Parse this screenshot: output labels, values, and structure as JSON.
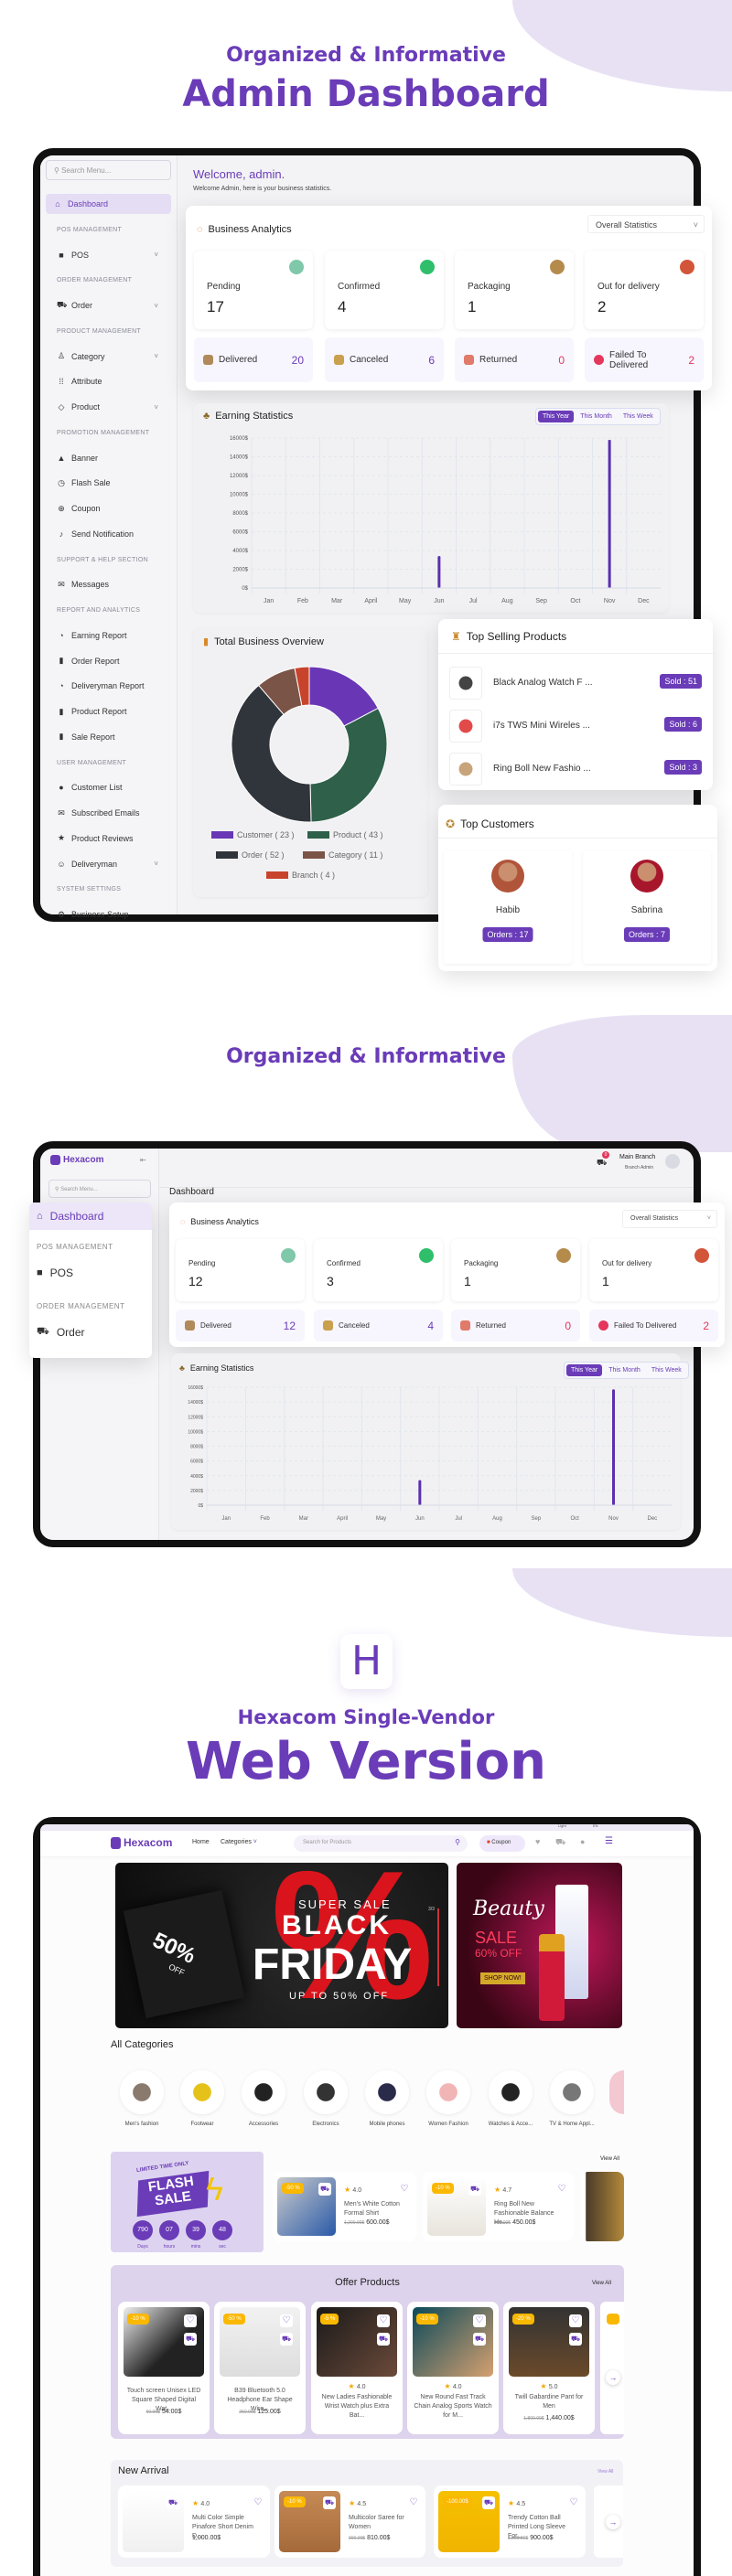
{
  "colors": {
    "accent": "#6a3cb8",
    "danger": "#e5365b",
    "lavender": "#e8e1f4",
    "bar": "#5b2fb0"
  },
  "section1": {
    "kicker": "Organized & Informative",
    "title": "Admin Dashboard"
  },
  "admin": {
    "search_placeholder": "Search Menu...",
    "sidebar": [
      {
        "type": "item",
        "label": "Dashboard",
        "icon": "home-icon",
        "active": true
      },
      {
        "type": "header",
        "label": "POS MANAGEMENT"
      },
      {
        "type": "item",
        "label": "POS",
        "icon": "bag-icon",
        "chevron": true
      },
      {
        "type": "header",
        "label": "ORDER MANAGEMENT"
      },
      {
        "type": "item",
        "label": "Order",
        "icon": "cart-icon",
        "chevron": true
      },
      {
        "type": "header",
        "label": "PRODUCT MANAGEMENT"
      },
      {
        "type": "item",
        "label": "Category",
        "icon": "category-icon",
        "chevron": true
      },
      {
        "type": "item",
        "label": "Attribute",
        "icon": "grid-icon"
      },
      {
        "type": "item",
        "label": "Product",
        "icon": "product-icon",
        "chevron": true
      },
      {
        "type": "header",
        "label": "PROMOTION MANAGEMENT"
      },
      {
        "type": "item",
        "label": "Banner",
        "icon": "image-icon"
      },
      {
        "type": "item",
        "label": "Flash Sale",
        "icon": "alarm-icon"
      },
      {
        "type": "item",
        "label": "Coupon",
        "icon": "coupon-icon"
      },
      {
        "type": "item",
        "label": "Send Notification",
        "icon": "bell-icon"
      },
      {
        "type": "header",
        "label": "SUPPORT & HELP SECTION"
      },
      {
        "type": "item",
        "label": "Messages",
        "icon": "message-icon"
      },
      {
        "type": "header",
        "label": "REPORT AND ANALYTICS"
      },
      {
        "type": "item",
        "label": "Earning Report",
        "icon": "pie-icon"
      },
      {
        "type": "item",
        "label": "Order Report",
        "icon": "bar-chart-icon"
      },
      {
        "type": "item",
        "label": "Deliveryman Report",
        "icon": "pie-icon"
      },
      {
        "type": "item",
        "label": "Product Report",
        "icon": "bar-chart-icon"
      },
      {
        "type": "item",
        "label": "Sale Report",
        "icon": "bar-chart-icon"
      },
      {
        "type": "header",
        "label": "USER MANAGEMENT"
      },
      {
        "type": "item",
        "label": "Customer List",
        "icon": "user-icon"
      },
      {
        "type": "item",
        "label": "Subscribed Emails",
        "icon": "mail-icon"
      },
      {
        "type": "item",
        "label": "Product Reviews",
        "icon": "star-icon"
      },
      {
        "type": "item",
        "label": "Deliveryman",
        "icon": "person-icon",
        "chevron": true
      },
      {
        "type": "header",
        "label": "SYSTEM SETTINGS"
      },
      {
        "type": "item",
        "label": "Business Setup",
        "icon": "gear-icon"
      }
    ],
    "welcome": "Welcome, admin.",
    "welcome_sub": "Welcome Admin, here is your business statistics.",
    "analytics": {
      "title": "Business Analytics",
      "filter": "Overall Statistics",
      "stats": [
        {
          "label": "Pending",
          "value": "17",
          "color": "#7fc8a9"
        },
        {
          "label": "Confirmed",
          "value": "4",
          "color": "#2fbf6b"
        },
        {
          "label": "Packaging",
          "value": "1",
          "color": "#b58b4c"
        },
        {
          "label": "Out for delivery",
          "value": "2",
          "color": "#d2553a"
        }
      ],
      "statuses": [
        {
          "label": "Delivered",
          "value": "20",
          "color": "#6a3cb8",
          "icon": "#b08a5a"
        },
        {
          "label": "Canceled",
          "value": "6",
          "color": "#6a3cb8",
          "icon": "#c9a04e"
        },
        {
          "label": "Returned",
          "value": "0",
          "color": "#e5365b",
          "icon": "#e07a6a"
        },
        {
          "label": "Failed To Delivered",
          "value": "2",
          "color": "#e5365b",
          "icon": "#e5365b"
        }
      ]
    },
    "earning": {
      "title": "Earning Statistics",
      "tabs": [
        "This Year",
        "This Month",
        "This Week"
      ]
    },
    "overview": {
      "title": "Total Business Overview"
    },
    "top_selling": {
      "title": "Top Selling Products",
      "items": [
        {
          "name": "Black Analog Watch F ...",
          "sold": "Sold : 51"
        },
        {
          "name": "i7s TWS Mini Wireles ...",
          "sold": "Sold : 6"
        },
        {
          "name": "Ring Boll New Fashio ...",
          "sold": "Sold : 3"
        }
      ]
    },
    "top_customers": {
      "title": "Top Customers",
      "items": [
        {
          "name": "Habib",
          "orders": "Orders : 17"
        },
        {
          "name": "Sabrina",
          "orders": "Orders : 7"
        }
      ]
    }
  },
  "section2": {
    "kicker": "Organized & Informative"
  },
  "branch": {
    "logo": "Hexacom",
    "search_placeholder": "Search Menu...",
    "cart_count": "0",
    "branch_name": "Main Branch",
    "branch_role": "Branch Admin",
    "page_title": "Dashboard",
    "menu": [
      {
        "type": "item",
        "label": "Dashboard",
        "icon": "home-icon",
        "active": true
      },
      {
        "type": "header",
        "label": "POS MANAGEMENT"
      },
      {
        "type": "item",
        "label": "POS",
        "icon": "bag-icon"
      },
      {
        "type": "header",
        "label": "ORDER MANAGEMENT"
      },
      {
        "type": "item",
        "label": "Order",
        "icon": "cart-icon"
      }
    ],
    "analytics": {
      "title": "Business Analytics",
      "filter": "Overall Statistics",
      "stats": [
        {
          "label": "Pending",
          "value": "12",
          "color": "#7fc8a9"
        },
        {
          "label": "Confirmed",
          "value": "3",
          "color": "#2fbf6b"
        },
        {
          "label": "Packaging",
          "value": "1",
          "color": "#b58b4c"
        },
        {
          "label": "Out for delivery",
          "value": "1",
          "color": "#d2553a"
        }
      ],
      "statuses": [
        {
          "label": "Delivered",
          "value": "12",
          "color": "#6a3cb8",
          "icon": "#b08a5a"
        },
        {
          "label": "Canceled",
          "value": "4",
          "color": "#6a3cb8",
          "icon": "#c9a04e"
        },
        {
          "label": "Returned",
          "value": "0",
          "color": "#e5365b",
          "icon": "#e07a6a"
        },
        {
          "label": "Failed To Delivered",
          "value": "2",
          "color": "#e5365b",
          "icon": "#e5365b"
        }
      ]
    },
    "earning": {
      "title": "Earning Statistics",
      "tabs": [
        "This Year",
        "This Month",
        "This Week"
      ]
    }
  },
  "section3": {
    "subtitle": "Hexacom Single-Vendor",
    "title": "Web Version",
    "logo_letter": "H"
  },
  "web": {
    "topbar": {
      "theme": "Light",
      "lang": "EN"
    },
    "logo": "Hexacom",
    "nav": [
      "Home",
      "Categories"
    ],
    "search_placeholder": "Search for Products",
    "coupon": "Coupon",
    "banner": {
      "kicker": "SUPER SALE",
      "line1": "BLACK",
      "line2": "FRIDAY",
      "foot": "UP TO 50% OFF",
      "bag": "50%",
      "bag_sub": "OFF",
      "pager": "3/3"
    },
    "side_banner": {
      "title": "Beauty",
      "sale": "SALE",
      "off": "60% OFF",
      "cta": "SHOP NOW!"
    },
    "categories_title": "All Categories",
    "categories": [
      "Men's fashion",
      "Footwear",
      "Accessories",
      "Electronics",
      "Mobile phones",
      "Women Fashion",
      "Watches & Acce...",
      "TV & Home Appl..."
    ],
    "flash": {
      "kicker": "LIMITED TIME ONLY",
      "title": "FLASH SALE",
      "countdown": [
        {
          "v": "790",
          "l": "Days"
        },
        {
          "v": "07",
          "l": "hours"
        },
        {
          "v": "39",
          "l": "mins"
        },
        {
          "v": "48",
          "l": "sec"
        }
      ],
      "view_all": "View All",
      "products": [
        {
          "discount": "-50 %",
          "rating": "4.0",
          "name": "Men's White Cotton Formal Shirt",
          "old": "1,200.00$",
          "price": "600.00$"
        },
        {
          "discount": "-10 %",
          "rating": "4.7",
          "name": "Ring Boll New Fashionable Balance He...",
          "old": "500.00$",
          "price": "450.00$"
        }
      ]
    },
    "offer": {
      "title": "Offer Products",
      "view_all": "View All",
      "products": [
        {
          "discount": "-10 %",
          "rating": "",
          "name": "Touch screen Unisex LED Square Shaped Digital Wat...",
          "old": "60.00$",
          "price": "54.00$"
        },
        {
          "discount": "-50 %",
          "rating": "",
          "name": "B39 Bluetooth 5.0 Headphone Ear Shape Wire...",
          "old": "250.00$",
          "price": "125.00$"
        },
        {
          "discount": "-5 %",
          "rating": "4.0",
          "name": "New Ladies Fashionable Wrist Watch plus Extra Bat...",
          "old": "",
          "price": ""
        },
        {
          "discount": "-10 %",
          "rating": "4.0",
          "name": "New Round Fast Track Chain Analog Sports Watch for M...",
          "old": "",
          "price": ""
        },
        {
          "discount": "-20 %",
          "rating": "5.0",
          "name": "Twill Gabardine Pant for Men",
          "old": "1,800.00$",
          "price": "1,440.00$"
        }
      ]
    },
    "new_arrival": {
      "title": "New Arrival",
      "view_all": "View All",
      "products": [
        {
          "discount": "",
          "rating": "4.0",
          "name": "Multi Color Simple Pinafore Short Denim D...",
          "old": "",
          "price": "1,000.00$"
        },
        {
          "discount": "-10 %",
          "rating": "4.5",
          "name": "Multicolor Saree for Women",
          "old": "900.00$",
          "price": "810.00$"
        },
        {
          "discount": "-100.00$",
          "rating": "4.5",
          "name": "Trendy Cotton Ball Printed Long Sleeve For...",
          "old": "1,000.00$",
          "price": "900.00$"
        }
      ]
    }
  },
  "chart_data": [
    {
      "type": "bar",
      "ylabel": "",
      "xlabel": "",
      "categories": [
        "Jan",
        "Feb",
        "Mar",
        "April",
        "May",
        "Jun",
        "Jul",
        "Aug",
        "Sep",
        "Oct",
        "Nov",
        "Dec"
      ],
      "values": [
        0,
        0,
        0,
        0,
        0,
        34000,
        0,
        0,
        0,
        0,
        158000,
        0
      ],
      "ylim": [
        0,
        160000
      ],
      "yticks": [
        "0$",
        "2000$",
        "4000$",
        "6000$",
        "8000$",
        "10000$",
        "12000$",
        "14000$",
        "16000$"
      ],
      "ytick_values": [
        0,
        20000,
        40000,
        60000,
        80000,
        100000,
        120000,
        140000,
        160000
      ],
      "grid": true
    },
    {
      "type": "pie",
      "donut": true,
      "categories": [
        "Customer",
        "Product",
        "Order",
        "Category",
        "Branch"
      ],
      "values": [
        23,
        43,
        52,
        11,
        4
      ],
      "colors": [
        "#6937b5",
        "#2f6049",
        "#30343b",
        "#7b5448",
        "#c8432b"
      ],
      "legend": [
        "Customer ( 23 )",
        "Product ( 43 )",
        "Order ( 52 )",
        "Category ( 11 )",
        "Branch ( 4 )"
      ],
      "legend_position": "bottom"
    },
    {
      "type": "bar",
      "categories": [
        "Jan",
        "Feb",
        "Mar",
        "April",
        "May",
        "Jun",
        "Jul",
        "Aug",
        "Sep",
        "Oct",
        "Nov",
        "Dec"
      ],
      "values": [
        0,
        0,
        0,
        0,
        0,
        34000,
        0,
        0,
        0,
        0,
        157000,
        0
      ],
      "ylim": [
        0,
        160000
      ],
      "yticks": [
        "0$",
        "2000$",
        "4000$",
        "6000$",
        "8000$",
        "10000$",
        "12000$",
        "14000$",
        "16000$"
      ],
      "ytick_values": [
        0,
        20000,
        40000,
        60000,
        80000,
        100000,
        120000,
        140000,
        160000
      ],
      "grid": true
    }
  ]
}
